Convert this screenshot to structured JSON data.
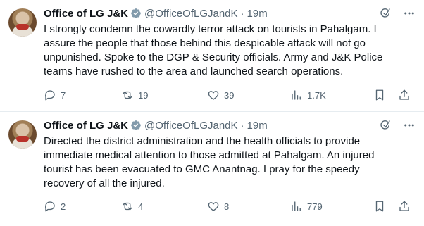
{
  "tweets": [
    {
      "author": "Office of LG J&K",
      "handle": "@OfficeOfLGJandK",
      "separator": "·",
      "time": "19m",
      "text": "I strongly condemn the cowardly terror attack on tourists in Pahalgam. I\nassure the people that those behind this despicable attack will not go\nunpunished. Spoke to the DGP & Security officials. Army and J&K Police\nteams have rushed to the area and launched search operations.",
      "replies": "7",
      "reposts": "19",
      "likes": "39",
      "views": "1.7K"
    },
    {
      "author": "Office of LG J&K",
      "handle": "@OfficeOfLGJandK",
      "separator": "·",
      "time": "19m",
      "text": "Directed the district administration and the health officials to provide\nimmediate medical attention to those admitted at Pahalgam. An injured\ntourist has been evacuated to GMC Anantnag. I pray for the speedy\nrecovery of all the injured.",
      "replies": "2",
      "reposts": "4",
      "likes": "8",
      "views": "779"
    }
  ],
  "colors": {
    "text": "#0f1419",
    "secondary": "#536471",
    "verified_badge": "#829aab",
    "divider": "#e6ecf0"
  },
  "icons": {
    "verified": "verified-badge-icon",
    "grok": "grok-icon",
    "more": "more-options-icon",
    "reply": "reply-icon",
    "repost": "repost-icon",
    "like": "like-icon",
    "views": "views-icon",
    "bookmark": "bookmark-icon",
    "share": "share-icon"
  }
}
